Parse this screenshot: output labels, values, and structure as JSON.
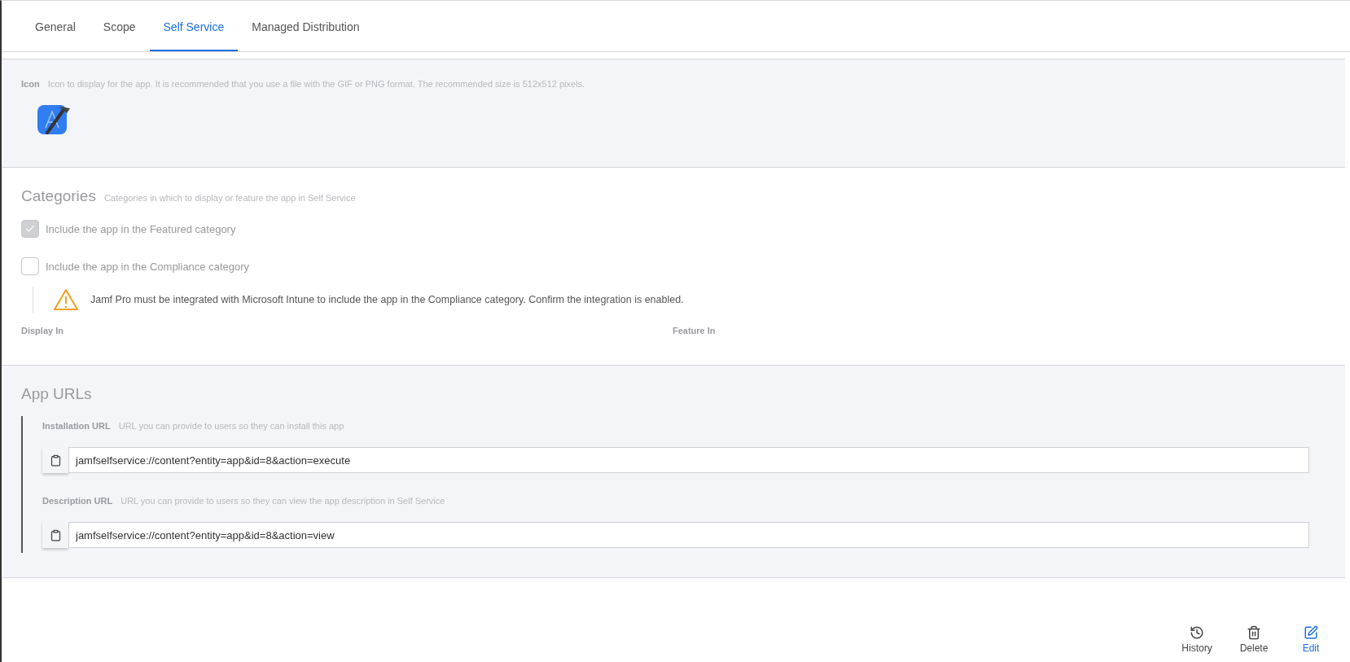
{
  "tabs": [
    {
      "label": "General",
      "selected": false
    },
    {
      "label": "Scope",
      "selected": false
    },
    {
      "label": "Self Service",
      "selected": true
    },
    {
      "label": "Managed Distribution",
      "selected": false
    }
  ],
  "icon_section": {
    "label": "Icon",
    "description": "Icon to display for the app. It is recommended that you use a file with the GIF or PNG format. The recommended size is 512x512 pixels."
  },
  "categories": {
    "title": "Categories",
    "description": "Categories in which to display or feature the app in Self Service",
    "options": [
      {
        "label": "Include the app in the Featured category",
        "checked": true
      },
      {
        "label": "Include the app in the Compliance category",
        "checked": false
      }
    ],
    "warning": "Jamf Pro must be integrated with Microsoft Intune to include the app in the Compliance category. Confirm the integration is enabled.",
    "columns": [
      "Display In",
      "Feature In"
    ]
  },
  "app_urls": {
    "title": "App URLs",
    "fields": [
      {
        "label": "Installation URL",
        "description": "URL you can provide to users so they can install this app",
        "value": "jamfselfservice://content?entity=app&id=8&action=execute"
      },
      {
        "label": "Description URL",
        "description": "URL you can provide to users so they can view the app description in Self Service",
        "value": "jamfselfservice://content?entity=app&id=8&action=view"
      }
    ]
  },
  "actions": [
    {
      "kind": "history",
      "label": "History",
      "primary": false
    },
    {
      "kind": "delete",
      "label": "Delete",
      "primary": false
    },
    {
      "kind": "edit",
      "label": "Edit",
      "primary": true
    }
  ]
}
